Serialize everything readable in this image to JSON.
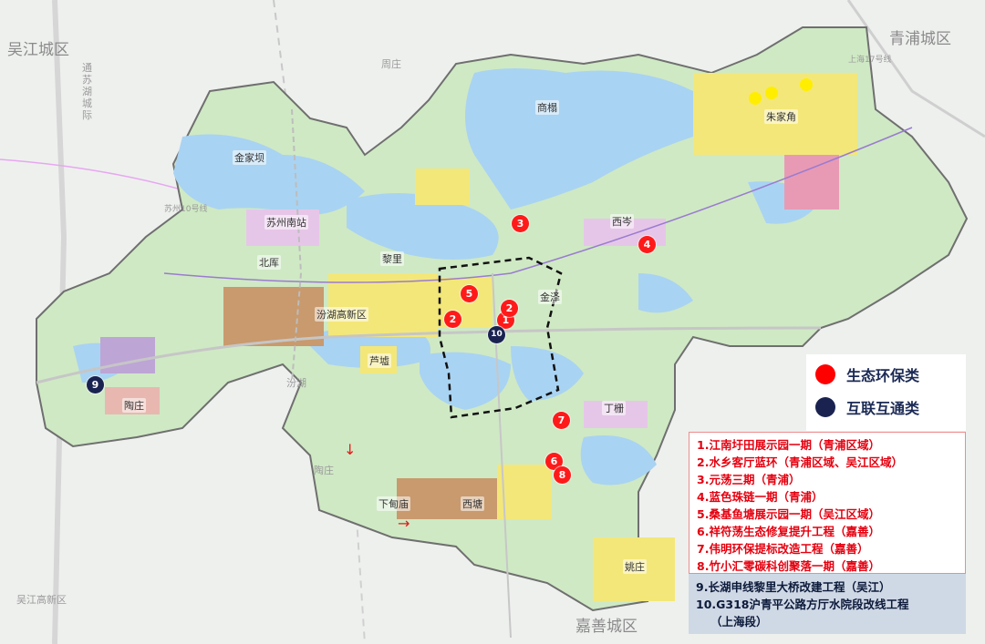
{
  "regions": {
    "wujiang": "吴江城区",
    "qingpu": "青浦城区",
    "jiashan": "嘉善城区",
    "wujiang_hi": "吴江高新区",
    "zhouzhuang": "周庄",
    "taoyuan": "陶庄"
  },
  "places": {
    "zhujiajiao": "朱家角",
    "jinjiaba": "金家坝",
    "suzhou_south": "苏州南站",
    "beishe": "北厍",
    "fenhu": "汾湖高新区",
    "lili": "黎里",
    "xitang": "西塘",
    "xiadianmiao": "下甸庙",
    "yaozhuang": "姚庄",
    "luxu": "芦墟",
    "dingzha": "丁栅",
    "xicen": "西岑",
    "jinze": "金泽",
    "shangta": "商榻",
    "taozhuang2": "陶庄",
    "tongsu_canal": "通苏湖城际",
    "subway10": "苏州10号线",
    "river": "汾湖",
    "zhujiajiao_rail": "上海17号线"
  },
  "markers": [
    {
      "id": "1",
      "type": "eco"
    },
    {
      "id": "2",
      "type": "eco"
    },
    {
      "id": "2",
      "type": "eco"
    },
    {
      "id": "3",
      "type": "eco"
    },
    {
      "id": "4",
      "type": "eco"
    },
    {
      "id": "5",
      "type": "eco"
    },
    {
      "id": "6",
      "type": "eco"
    },
    {
      "id": "7",
      "type": "eco"
    },
    {
      "id": "8",
      "type": "eco"
    },
    {
      "id": "9",
      "type": "conn"
    },
    {
      "id": "10",
      "type": "conn"
    }
  ],
  "legend": {
    "eco_label": "生态环保类",
    "conn_label": "互联互通类",
    "eco_color": "#ff0000",
    "conn_color": "#1a2350"
  },
  "eco_projects": [
    "1.江南圩田展示园一期（青浦区域）",
    "2.水乡客厅蓝环（青浦区域、吴江区域）",
    "3.元荡三期（青浦）",
    "4.蓝色珠链一期（青浦）",
    "5.桑基鱼塘展示园一期（吴江区域）",
    "6.祥符荡生态修复提升工程（嘉善）",
    "7.伟明环保提标改造工程（嘉善）",
    "8.竹小汇零碳科创聚落一期（嘉善）"
  ],
  "conn_projects": [
    "9.长湖申线黎里大桥改建工程（吴江）",
    "10.G318沪青平公路方厅水院段改线工程",
    "（上海段）"
  ]
}
